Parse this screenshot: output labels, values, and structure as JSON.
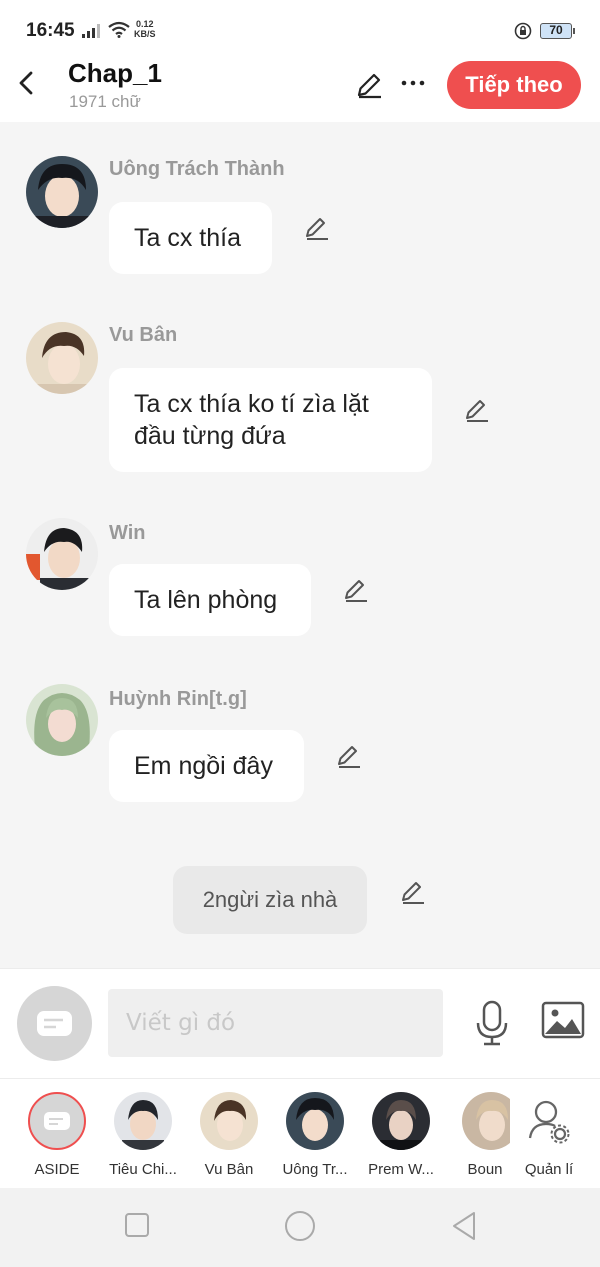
{
  "status_bar": {
    "time": "16:45",
    "speed_value": "0.12",
    "speed_unit": "KB/S",
    "battery": "70"
  },
  "header": {
    "title": "Chap_1",
    "word_count": "1971 chữ",
    "next_button": "Tiếp theo",
    "accent_color": "#ef4f4f"
  },
  "messages": [
    {
      "name": "Uông Trách Thành",
      "text": "Ta cx thía",
      "avatar_icon": "character-avatar"
    },
    {
      "name": "Vu Bân",
      "text_line1": "Ta cx thía ko tí zìa lặt",
      "text_line2": "đầu từng đứa",
      "avatar_icon": "character-avatar"
    },
    {
      "name": "Win",
      "text": "Ta lên phòng",
      "avatar_icon": "character-avatar"
    },
    {
      "name": "Huỳnh Rin[t.g]",
      "text": "Em ngồi đây",
      "avatar_icon": "character-avatar"
    }
  ],
  "narration": {
    "text": "2ngừi zìa nhà"
  },
  "composer": {
    "placeholder": "Viết gì đó",
    "icons": [
      "aside-icon",
      "microphone-icon",
      "image-icon"
    ]
  },
  "characters": [
    {
      "label": "ASIDE"
    },
    {
      "label": "Tiêu Chi..."
    },
    {
      "label": "Vu Bân"
    },
    {
      "label": "Uông Tr..."
    },
    {
      "label": "Prem W..."
    },
    {
      "label": "Boun"
    },
    {
      "label": "Quản lí"
    }
  ]
}
